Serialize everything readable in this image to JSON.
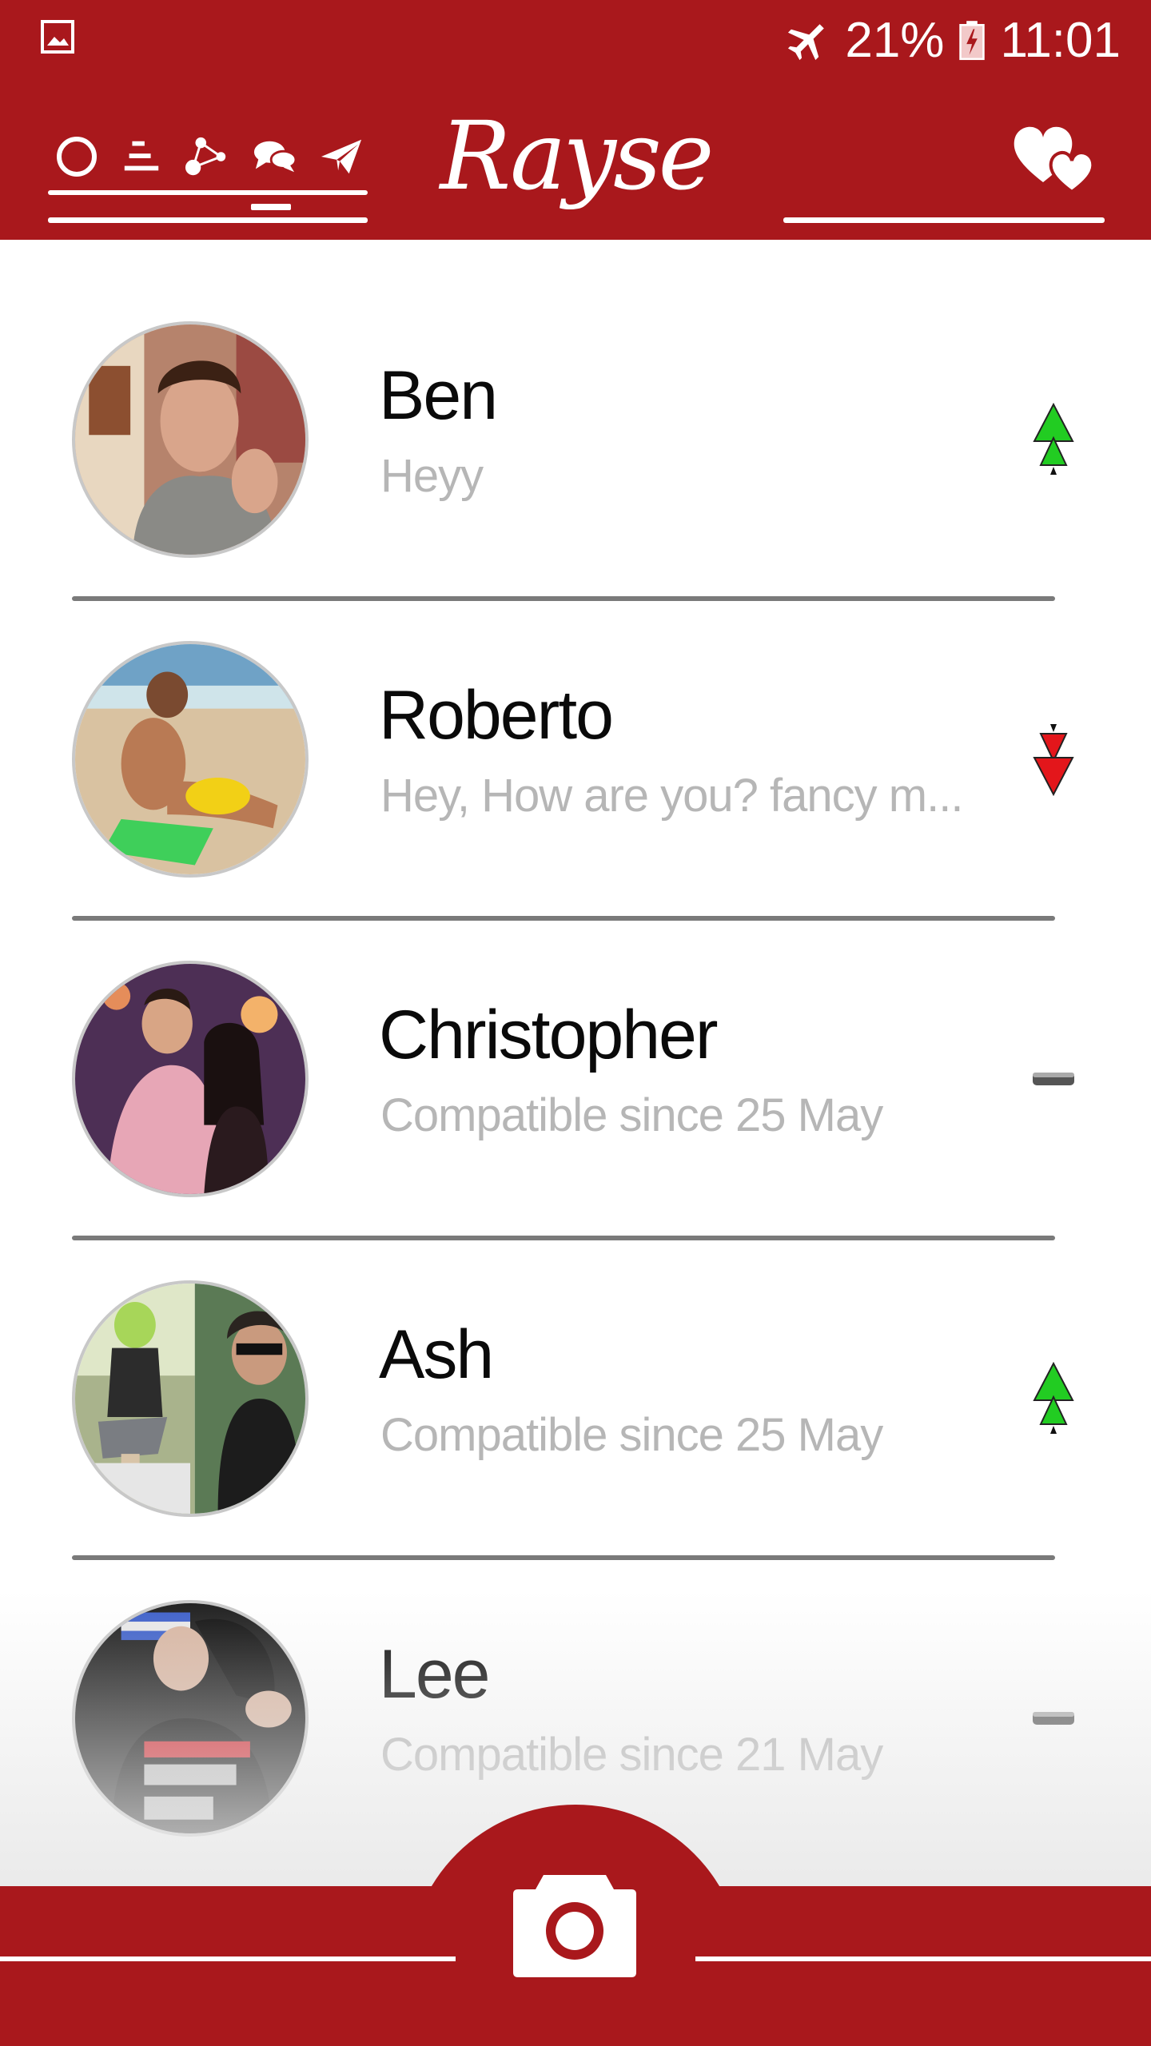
{
  "status": {
    "battery": "21%",
    "time": "11:01"
  },
  "app": {
    "logo_text": "Rayse"
  },
  "icons": {
    "nav": [
      "circle-icon",
      "stack-icon",
      "network-icon",
      "chat-bubbles-icon",
      "paper-plane-icon"
    ],
    "hearts": "hearts-icon",
    "camera": "camera-icon"
  },
  "colors": {
    "brand_red": "#a9181c",
    "up_green": "#22cc22",
    "down_red": "#e3161b"
  },
  "matches": [
    {
      "name": "Ben",
      "subtitle": "Heyy",
      "trend": "up"
    },
    {
      "name": "Roberto",
      "subtitle": "Hey, How are you? fancy m...",
      "trend": "down"
    },
    {
      "name": "Christopher",
      "subtitle": "Compatible since 25 May",
      "trend": "flat"
    },
    {
      "name": "Ash",
      "subtitle": "Compatible since 25 May",
      "trend": "up"
    },
    {
      "name": "Lee",
      "subtitle": "Compatible since 21 May",
      "trend": "flat"
    }
  ]
}
